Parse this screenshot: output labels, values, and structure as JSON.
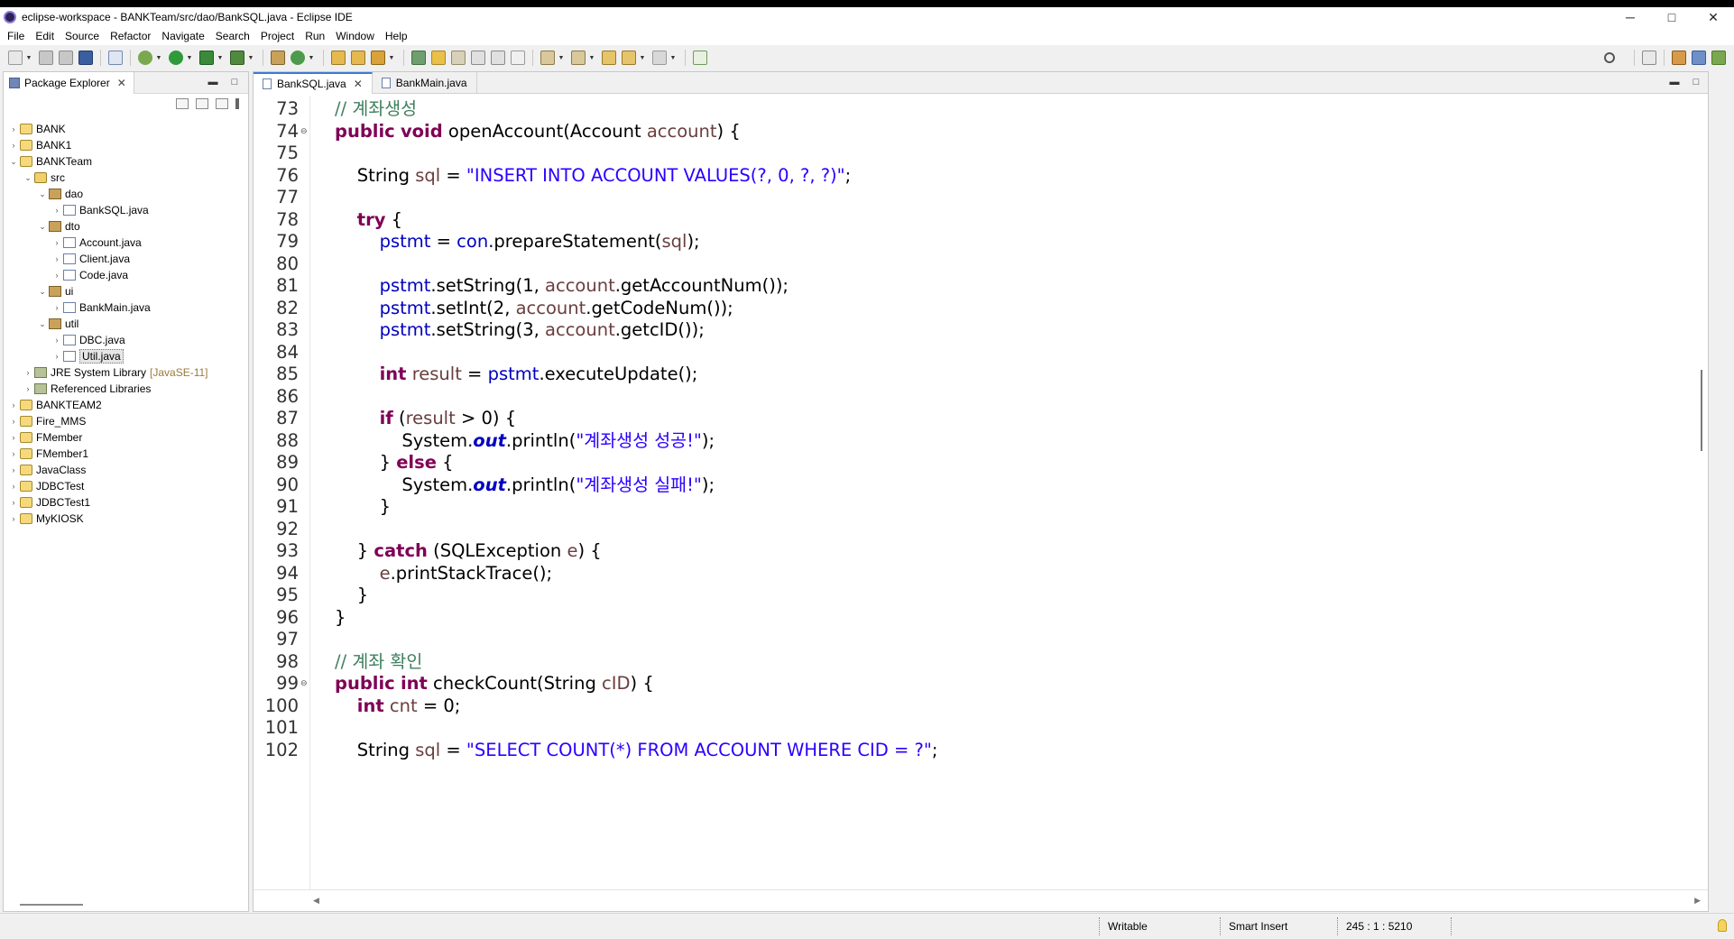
{
  "window": {
    "title": "eclipse-workspace - BANKTeam/src/dao/BankSQL.java - Eclipse IDE",
    "minimize": "─",
    "maximize": "□",
    "close": "✕"
  },
  "menu": [
    "File",
    "Edit",
    "Source",
    "Refactor",
    "Navigate",
    "Search",
    "Project",
    "Run",
    "Window",
    "Help"
  ],
  "package_explorer": {
    "tab_label": "Package Explorer",
    "tree": [
      {
        "label": "BANK",
        "icon": "project-icon",
        "twisty": "›"
      },
      {
        "label": "BANK1",
        "icon": "project-icon",
        "twisty": "›"
      },
      {
        "label": "BANKTeam",
        "icon": "project-icon",
        "twisty": "⌄"
      },
      {
        "label": "src",
        "icon": "source-folder-icon",
        "twisty": "⌄"
      },
      {
        "label": "dao",
        "icon": "package-icon",
        "twisty": "⌄"
      },
      {
        "label": "BankSQL.java",
        "icon": "java-file-icon",
        "twisty": "›"
      },
      {
        "label": "dto",
        "icon": "package-icon",
        "twisty": "⌄"
      },
      {
        "label": "Account.java",
        "icon": "java-file-icon",
        "twisty": "›"
      },
      {
        "label": "Client.java",
        "icon": "java-file-icon",
        "twisty": "›"
      },
      {
        "label": "Code.java",
        "icon": "java-file-icon",
        "twisty": "›"
      },
      {
        "label": "ui",
        "icon": "package-icon",
        "twisty": "⌄"
      },
      {
        "label": "BankMain.java",
        "icon": "java-file-icon",
        "twisty": "›"
      },
      {
        "label": "util",
        "icon": "package-icon",
        "twisty": "⌄"
      },
      {
        "label": "DBC.java",
        "icon": "java-file-icon",
        "twisty": "›"
      },
      {
        "label": "Util.java",
        "icon": "java-file-icon",
        "twisty": "›",
        "selected": true
      },
      {
        "label": "JRE System Library",
        "decor": "[JavaSE-11]",
        "icon": "library-icon",
        "twisty": "›"
      },
      {
        "label": "Referenced Libraries",
        "icon": "library-icon",
        "twisty": "›"
      },
      {
        "label": "BANKTEAM2",
        "icon": "project-icon",
        "twisty": "›"
      },
      {
        "label": "Fire_MMS",
        "icon": "project-icon",
        "twisty": "›"
      },
      {
        "label": "FMember",
        "icon": "project-icon",
        "twisty": "›"
      },
      {
        "label": "FMember1",
        "icon": "project-icon",
        "twisty": "›"
      },
      {
        "label": "JavaClass",
        "icon": "project-icon",
        "twisty": "›"
      },
      {
        "label": "JDBCTest",
        "icon": "project-icon",
        "twisty": "›"
      },
      {
        "label": "JDBCTest1",
        "icon": "project-icon",
        "twisty": "›"
      },
      {
        "label": "MyKIOSK",
        "icon": "project-icon",
        "twisty": "›"
      }
    ]
  },
  "editor": {
    "tabs": [
      {
        "label": "BankSQL.java",
        "active": true
      },
      {
        "label": "BankMain.java",
        "active": false
      }
    ],
    "lines": [
      {
        "n": "73",
        "fold": "",
        "tokens": [
          {
            "t": "// 계좌생성",
            "c": "c"
          }
        ]
      },
      {
        "n": "74",
        "fold": "⊖",
        "tokens": [
          {
            "t": "public",
            "c": "k"
          },
          {
            "t": " "
          },
          {
            "t": "void",
            "c": "k"
          },
          {
            "t": " openAccount(Account "
          },
          {
            "t": "account",
            "c": "v"
          },
          {
            "t": ") {"
          }
        ]
      },
      {
        "n": "75",
        "fold": "",
        "tokens": []
      },
      {
        "n": "76",
        "fold": "",
        "tokens": [
          {
            "t": "    String "
          },
          {
            "t": "sql",
            "c": "v"
          },
          {
            "t": " = "
          },
          {
            "t": "\"INSERT INTO ACCOUNT VALUES(?, 0, ?, ?)\"",
            "c": "s"
          },
          {
            "t": ";"
          }
        ]
      },
      {
        "n": "77",
        "fold": "",
        "tokens": []
      },
      {
        "n": "78",
        "fold": "",
        "tokens": [
          {
            "t": "    "
          },
          {
            "t": "try",
            "c": "k"
          },
          {
            "t": " {"
          }
        ]
      },
      {
        "n": "79",
        "fold": "",
        "tokens": [
          {
            "t": "        "
          },
          {
            "t": "pstmt",
            "c": "f"
          },
          {
            "t": " = "
          },
          {
            "t": "con",
            "c": "f"
          },
          {
            "t": ".prepareStatement("
          },
          {
            "t": "sql",
            "c": "v"
          },
          {
            "t": ");"
          }
        ]
      },
      {
        "n": "80",
        "fold": "",
        "tokens": []
      },
      {
        "n": "81",
        "fold": "",
        "tokens": [
          {
            "t": "        "
          },
          {
            "t": "pstmt",
            "c": "f"
          },
          {
            "t": ".setString(1, "
          },
          {
            "t": "account",
            "c": "v"
          },
          {
            "t": ".getAccountNum());"
          }
        ]
      },
      {
        "n": "82",
        "fold": "",
        "tokens": [
          {
            "t": "        "
          },
          {
            "t": "pstmt",
            "c": "f"
          },
          {
            "t": ".setInt(2, "
          },
          {
            "t": "account",
            "c": "v"
          },
          {
            "t": ".getCodeNum());"
          }
        ]
      },
      {
        "n": "83",
        "fold": "",
        "tokens": [
          {
            "t": "        "
          },
          {
            "t": "pstmt",
            "c": "f"
          },
          {
            "t": ".setString(3, "
          },
          {
            "t": "account",
            "c": "v"
          },
          {
            "t": ".getcID());"
          }
        ]
      },
      {
        "n": "84",
        "fold": "",
        "tokens": []
      },
      {
        "n": "85",
        "fold": "",
        "tokens": [
          {
            "t": "        "
          },
          {
            "t": "int",
            "c": "k"
          },
          {
            "t": " "
          },
          {
            "t": "result",
            "c": "v"
          },
          {
            "t": " = "
          },
          {
            "t": "pstmt",
            "c": "f"
          },
          {
            "t": ".executeUpdate();"
          }
        ]
      },
      {
        "n": "86",
        "fold": "",
        "tokens": []
      },
      {
        "n": "87",
        "fold": "",
        "tokens": [
          {
            "t": "        "
          },
          {
            "t": "if",
            "c": "k"
          },
          {
            "t": " ("
          },
          {
            "t": "result",
            "c": "v"
          },
          {
            "t": " > 0) {"
          }
        ]
      },
      {
        "n": "88",
        "fold": "",
        "tokens": [
          {
            "t": "            System."
          },
          {
            "t": "out",
            "c": "sf"
          },
          {
            "t": ".println("
          },
          {
            "t": "\"계좌생성 성공!\"",
            "c": "s"
          },
          {
            "t": ");"
          }
        ]
      },
      {
        "n": "89",
        "fold": "",
        "tokens": [
          {
            "t": "        } "
          },
          {
            "t": "else",
            "c": "k"
          },
          {
            "t": " {"
          }
        ]
      },
      {
        "n": "90",
        "fold": "",
        "tokens": [
          {
            "t": "            System."
          },
          {
            "t": "out",
            "c": "sf"
          },
          {
            "t": ".println("
          },
          {
            "t": "\"계좌생성 실패!\"",
            "c": "s"
          },
          {
            "t": ");"
          }
        ]
      },
      {
        "n": "91",
        "fold": "",
        "tokens": [
          {
            "t": "        }"
          }
        ]
      },
      {
        "n": "92",
        "fold": "",
        "tokens": []
      },
      {
        "n": "93",
        "fold": "",
        "tokens": [
          {
            "t": "    } "
          },
          {
            "t": "catch",
            "c": "k"
          },
          {
            "t": " (SQLException "
          },
          {
            "t": "e",
            "c": "v"
          },
          {
            "t": ") {"
          }
        ]
      },
      {
        "n": "94",
        "fold": "",
        "tokens": [
          {
            "t": "        "
          },
          {
            "t": "e",
            "c": "v"
          },
          {
            "t": ".printStackTrace();"
          }
        ]
      },
      {
        "n": "95",
        "fold": "",
        "tokens": [
          {
            "t": "    }"
          }
        ]
      },
      {
        "n": "96",
        "fold": "",
        "tokens": [
          {
            "t": "}"
          }
        ]
      },
      {
        "n": "97",
        "fold": "",
        "tokens": []
      },
      {
        "n": "98",
        "fold": "",
        "tokens": [
          {
            "t": "// 계좌 확인",
            "c": "c"
          }
        ]
      },
      {
        "n": "99",
        "fold": "⊖",
        "tokens": [
          {
            "t": "public",
            "c": "k"
          },
          {
            "t": " "
          },
          {
            "t": "int",
            "c": "k"
          },
          {
            "t": " checkCount(String "
          },
          {
            "t": "cID",
            "c": "v"
          },
          {
            "t": ") {"
          }
        ]
      },
      {
        "n": "100",
        "fold": "",
        "tokens": [
          {
            "t": "    "
          },
          {
            "t": "int",
            "c": "k"
          },
          {
            "t": " "
          },
          {
            "t": "cnt",
            "c": "v"
          },
          {
            "t": " = 0;"
          }
        ]
      },
      {
        "n": "101",
        "fold": "",
        "tokens": []
      },
      {
        "n": "102",
        "fold": "",
        "tokens": [
          {
            "t": "    String "
          },
          {
            "t": "sql",
            "c": "v"
          },
          {
            "t": " = "
          },
          {
            "t": "\"SELECT COUNT(*) FROM ACCOUNT WHERE CID = ?\"",
            "c": "s"
          },
          {
            "t": ";"
          }
        ]
      }
    ]
  },
  "status": {
    "writable": "Writable",
    "insert_mode": "Smart Insert",
    "position": "245 : 1 : 5210"
  }
}
